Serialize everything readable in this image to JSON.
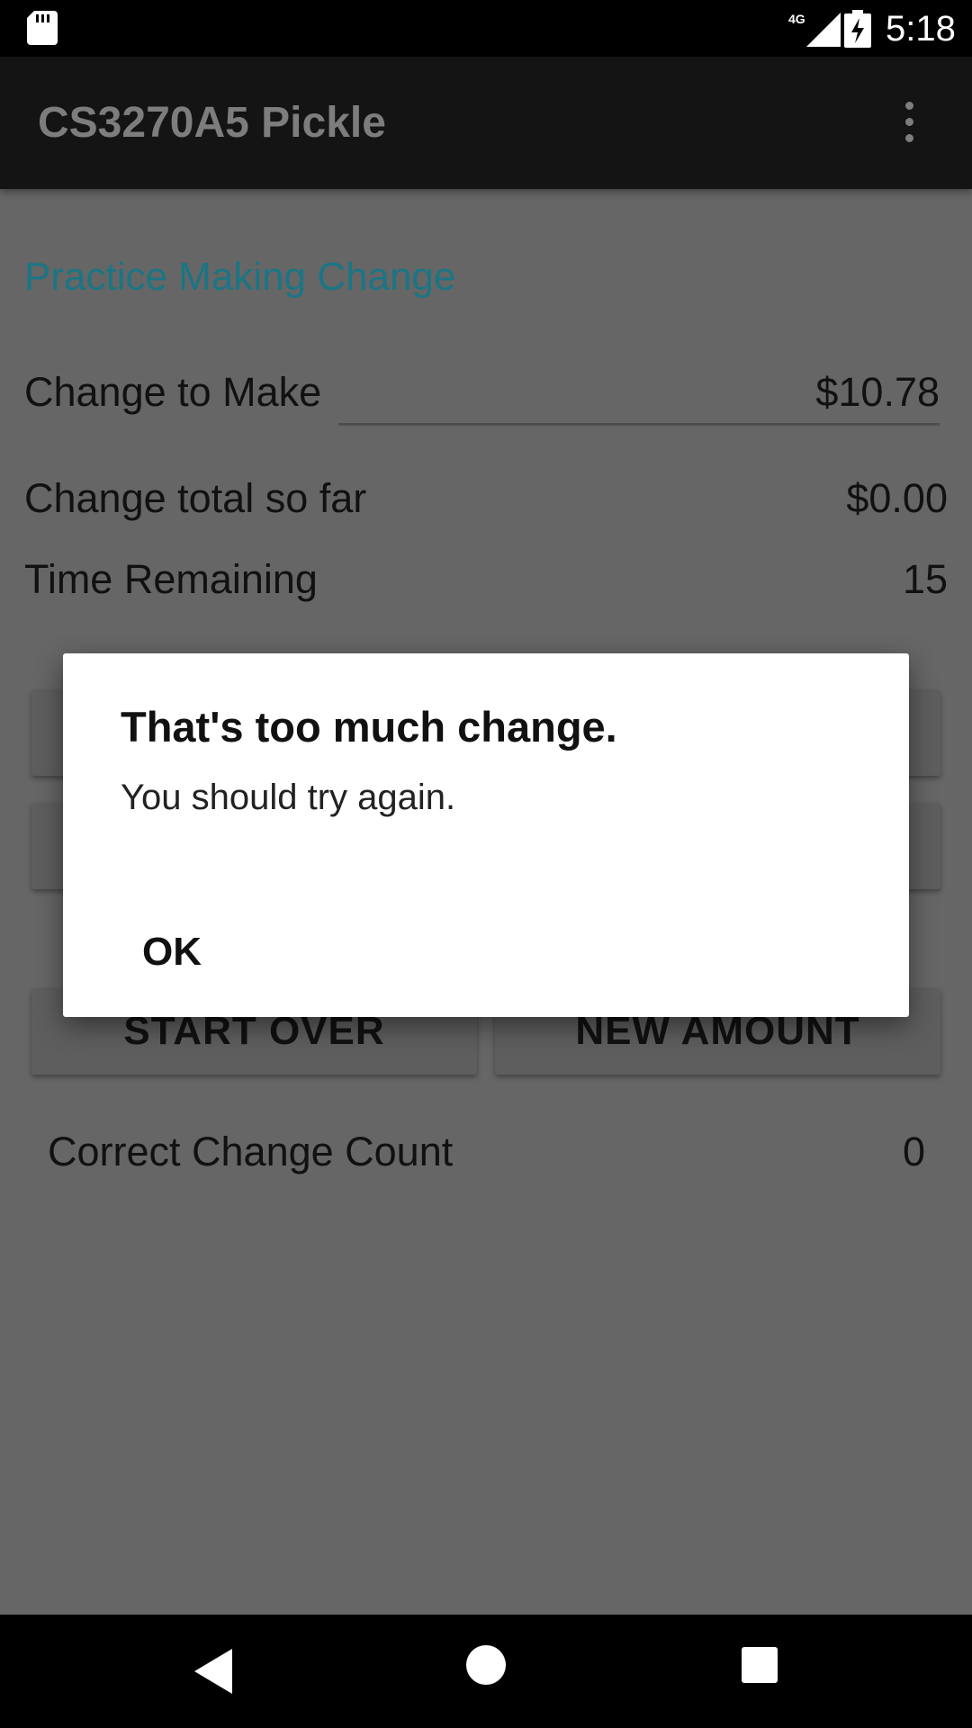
{
  "status_bar": {
    "time": "5:18",
    "network": "4G"
  },
  "app_bar": {
    "title": "CS3270A5 Pickle"
  },
  "main": {
    "section_title": "Practice Making Change",
    "change_to_make_label": "Change to Make",
    "change_to_make_value": "$10.78",
    "change_total_label": "Change total so far",
    "change_total_value": "$0.00",
    "time_remaining_label": "Time Remaining",
    "time_remaining_value": "15",
    "start_over_label": "START OVER",
    "new_amount_label": "NEW AMOUNT",
    "correct_count_label": "Correct Change Count",
    "correct_count_value": "0"
  },
  "dialog": {
    "title": "That's too much change.",
    "message": "You should try again.",
    "ok_label": "OK"
  },
  "colors": {
    "accent": "#1b7585",
    "scrim_background": "#666666",
    "dialog_background": "#ffffff"
  }
}
